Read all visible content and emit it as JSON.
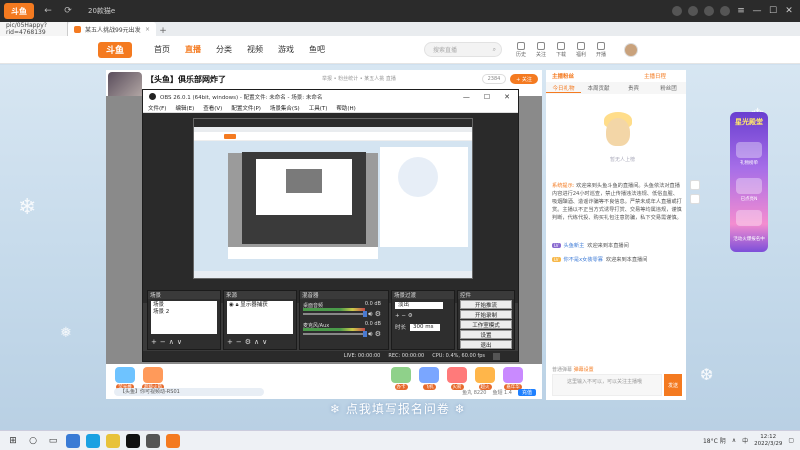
{
  "browser": {
    "logo_text": "斗鱼",
    "window_title": "20款猫e",
    "url": "pic/05Happy?rid=4768139",
    "tab_title": "某五人挑战99元出发",
    "tab_close": "×",
    "new_tab": "+"
  },
  "site": {
    "logo_text": "斗鱼",
    "nav": [
      "首页",
      "直播",
      "分类",
      "视频",
      "游戏",
      "鱼吧"
    ],
    "search_placeholder": "搜索直播",
    "header_icons": [
      "历史",
      "关注",
      "下载",
      "福利",
      "开播"
    ]
  },
  "room": {
    "title": "【头鱼】俱乐部网炸了",
    "meta": "举报  •  粉丝统计  •  某五人挑  直播",
    "badge": "热度 1",
    "viewer_count": "2384",
    "follow_label": "+ 关注"
  },
  "obs": {
    "title": "OBS 26.0.1 (64bit, windows) - 配置文件: 未命名 - 场景: 未命名",
    "menu": [
      "文件(F)",
      "编辑(E)",
      "查看(V)",
      "配置文件(P)",
      "场景集合(S)",
      "工具(T)",
      "帮助(H)"
    ],
    "window_controls": [
      "—",
      "☐",
      "✕"
    ],
    "docks": {
      "scenes_title": "场景",
      "scenes": [
        "场景",
        "场景 2"
      ],
      "sources_title": "来源",
      "sources": [
        "显示器捕获"
      ],
      "mixer_title": "混音器",
      "mixer": [
        {
          "name": "桌面音频",
          "db": "0.0 dB"
        },
        {
          "name": "麦克风/Aux",
          "db": "0.0 dB"
        }
      ],
      "transitions_title": "场景过渡",
      "transition_type": "淡出",
      "duration_label": "时长",
      "duration_value": "300 ms",
      "controls_title": "控件",
      "controls": [
        "开始推流",
        "开始录制",
        "工作室模式",
        "设置",
        "退出"
      ]
    },
    "status": {
      "live": "LIVE: 00:00:00",
      "rec": "REC: 00:00:00",
      "cpu": "CPU: 0.4%, 60.00 fps"
    }
  },
  "gifts": [
    {
      "label": "荧光棒",
      "color": "#6ec3ff"
    },
    {
      "label": "超级火箭",
      "color": "#ff9a5a"
    },
    {
      "label": "办卡",
      "color": "#8fd18a"
    },
    {
      "label": "飞机",
      "color": "#7aa6ff"
    },
    {
      "label": "火箭",
      "color": "#ff7a7a"
    },
    {
      "label": "超火",
      "color": "#ffb64a"
    },
    {
      "label": "嘉年华",
      "color": "#c98aff"
    }
  ],
  "giftbar": {
    "notice": "【头鱼】你可视频动-RS01",
    "stats": [
      "鱼丸 8220",
      "鱼翅 1.4"
    ],
    "pay": "充值"
  },
  "bottom_banner": "❄ 点我填写报名问卷 ❄",
  "right_panel": {
    "top_title": "主播粉丝",
    "top_right": "主播日程",
    "tabs": [
      "今日礼物",
      "本周贡献",
      "贵宾",
      "粉丝团"
    ],
    "caption": "暂无人上榜",
    "system_label": "系统提示:",
    "system_msg": "欢迎来到头鱼斗鱼的直播间。头鱼依法对直播内容进行24小时巡查，禁止传播违法违规、低俗血腥、吸烟酗酒、造谣诈骗等不良信息。严禁未成年人直播或打赏。主播以不正当方式诱导打赏、交易等均属违规，谨慎判断，代练代投、购买礼包注意防骗，私下交易需谨慎。",
    "lines": [
      {
        "level": "LV",
        "name": "头鱼新主",
        "text": "欢迎来到本直播间"
      },
      {
        "level": "LV",
        "name": "你不是x女装零寡",
        "text": "欢迎来到本直播间"
      }
    ],
    "mid_left": "普通弹幕",
    "mid_right": "弹幕设置",
    "input_placeholder": "这里输入不可以，可以关注主播哦",
    "send": "发送"
  },
  "promo": {
    "title": "星光殿堂",
    "items": [
      "礼物榜单",
      "已点亮N"
    ],
    "bottom": "活动火爆报名中"
  },
  "taskbar": {
    "weather": "18°C 阴",
    "lang": "中",
    "time": "12:12",
    "date": "2022/3/29"
  }
}
